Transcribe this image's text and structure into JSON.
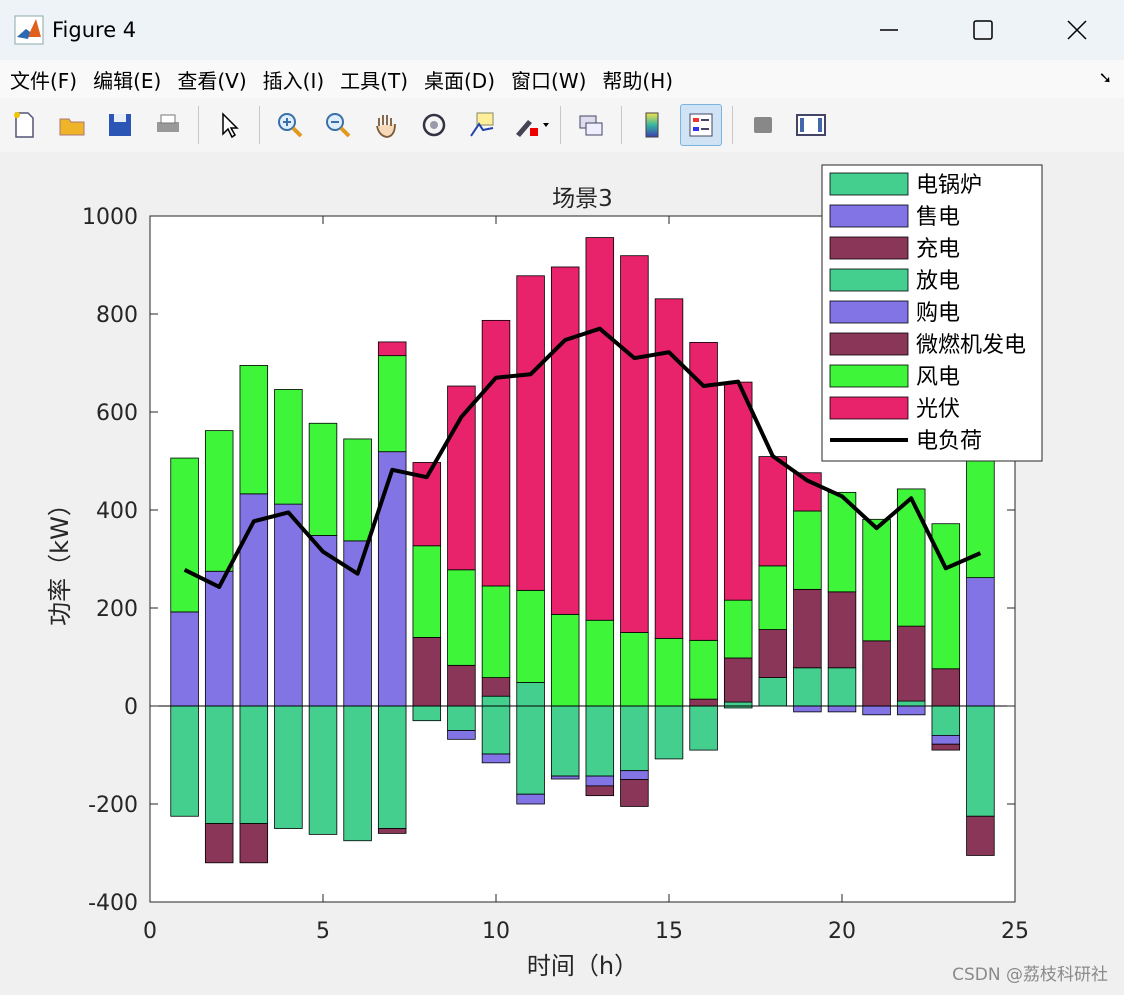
{
  "window": {
    "title": "Figure 4"
  },
  "menu": [
    "文件(F)",
    "编辑(E)",
    "查看(V)",
    "插入(I)",
    "工具(T)",
    "桌面(D)",
    "窗口(W)",
    "帮助(H)"
  ],
  "toolbar_icons": [
    "new-file-icon",
    "open-folder-icon",
    "save-icon",
    "print-icon",
    "pointer-icon",
    "zoom-in-icon",
    "zoom-out-icon",
    "pan-hand-icon",
    "rotate-3d-icon",
    "data-cursor-icon",
    "brush-icon",
    "link-plot-icon",
    "colorbar-icon",
    "legend-icon",
    "hide-plot-tools-icon",
    "show-plot-tools-icon"
  ],
  "colors": {
    "boiler": "#45cf8f",
    "sell": "#8374e6",
    "charge": "#8a3658",
    "wind": "#3ef53a",
    "pv": "#e8226b",
    "load": "#000000"
  },
  "watermark": "CSDN @荔枝科研社",
  "chart_data": {
    "type": "bar",
    "title": "场景3",
    "xlabel": "时间（h）",
    "ylabel": "功率（kW）",
    "xlim": [
      0,
      25
    ],
    "ylim": [
      -400,
      1000
    ],
    "xticks": [
      "0",
      "5",
      "10",
      "15",
      "20",
      "25"
    ],
    "yticks": [
      "-400",
      "-200",
      "0",
      "200",
      "400",
      "600",
      "800",
      "1000"
    ],
    "grid": false,
    "legend_position": "top-right",
    "x": [
      1,
      2,
      3,
      4,
      5,
      6,
      7,
      8,
      9,
      10,
      11,
      12,
      13,
      14,
      15,
      16,
      17,
      18,
      19,
      20,
      21,
      22,
      23,
      24
    ],
    "series": [
      {
        "name": "电锅炉",
        "color_key": "boiler",
        "values": [
          -225,
          -240,
          -240,
          -250,
          -262,
          -275,
          -250,
          -30,
          -50,
          -98,
          -180,
          -143,
          -143,
          -132,
          -108,
          -90,
          -4,
          0,
          0,
          0,
          0,
          0,
          -60,
          -225
        ]
      },
      {
        "name": "售电",
        "color_key": "sell",
        "values": [
          0,
          0,
          0,
          0,
          0,
          0,
          0,
          0,
          -18,
          -18,
          -20,
          -6,
          -20,
          -18,
          0,
          0,
          0,
          0,
          -12,
          -12,
          -18,
          -18,
          -18,
          0
        ]
      },
      {
        "name": "充电",
        "color_key": "charge",
        "values": [
          0,
          -80,
          -80,
          0,
          0,
          0,
          -10,
          0,
          0,
          0,
          0,
          0,
          -20,
          -55,
          0,
          0,
          0,
          0,
          0,
          0,
          0,
          0,
          -12,
          -80
        ]
      },
      {
        "name": "放电",
        "color_key": "boiler",
        "values": [
          0,
          0,
          0,
          0,
          0,
          0,
          0,
          0,
          0,
          20,
          48,
          0,
          0,
          0,
          0,
          0,
          8,
          58,
          78,
          78,
          0,
          10,
          0,
          0
        ]
      },
      {
        "name": "购电",
        "color_key": "sell",
        "values": [
          192,
          275,
          433,
          412,
          348,
          337,
          519,
          0,
          0,
          0,
          0,
          0,
          0,
          0,
          0,
          0,
          0,
          0,
          0,
          0,
          0,
          0,
          0,
          262
        ]
      },
      {
        "name": "微燃机发电",
        "color_key": "charge",
        "values": [
          0,
          0,
          0,
          0,
          0,
          0,
          0,
          140,
          83,
          38,
          0,
          0,
          0,
          0,
          0,
          14,
          90,
          98,
          160,
          155,
          133,
          153,
          76,
          0
        ]
      },
      {
        "name": "风电",
        "color_key": "wind",
        "values": [
          314,
          287,
          262,
          234,
          229,
          208,
          196,
          187,
          195,
          187,
          188,
          187,
          175,
          150,
          138,
          120,
          118,
          130,
          160,
          203,
          248,
          280,
          296,
          320
        ]
      },
      {
        "name": "光伏",
        "color_key": "pv",
        "values": [
          0,
          0,
          0,
          0,
          0,
          0,
          28,
          170,
          375,
          542,
          642,
          709,
          781,
          769,
          693,
          608,
          445,
          223,
          78,
          0,
          0,
          0,
          0,
          0
        ]
      }
    ],
    "line_series": {
      "name": "电负荷",
      "color_key": "load",
      "values": [
        278,
        243,
        377,
        395,
        315,
        270,
        482,
        467,
        590,
        670,
        677,
        747,
        770,
        710,
        722,
        653,
        662,
        510,
        460,
        428,
        363,
        424,
        281,
        312
      ]
    }
  }
}
